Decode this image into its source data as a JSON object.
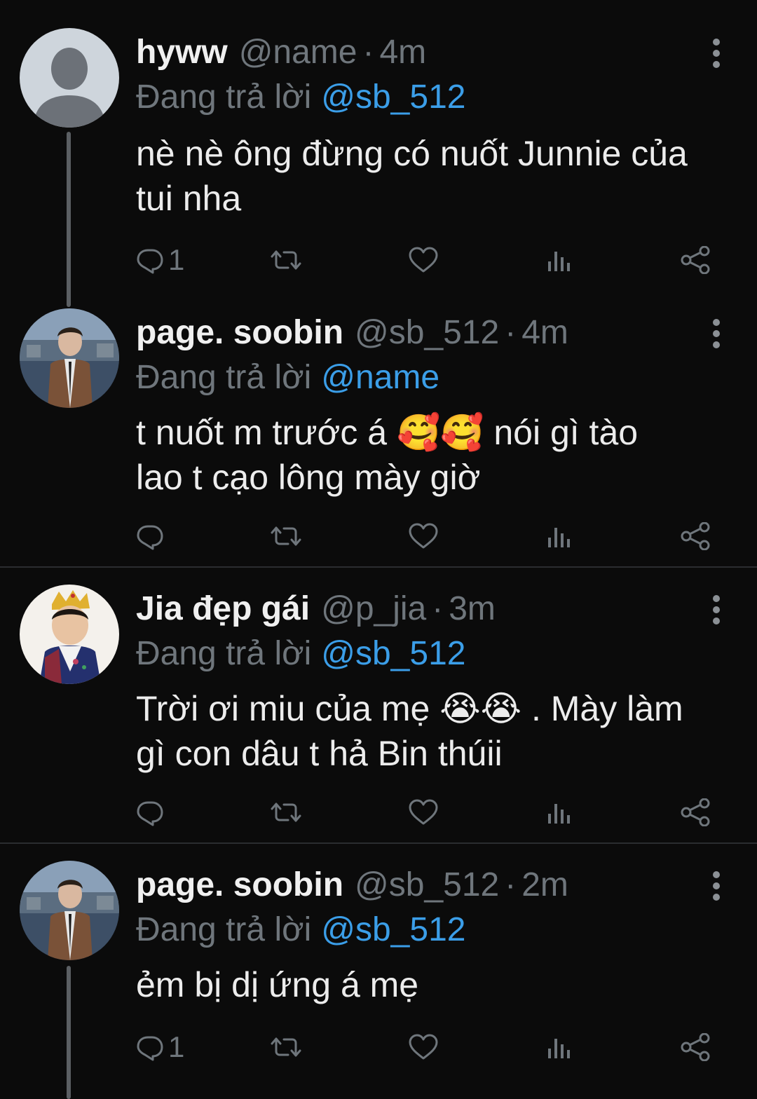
{
  "tweets": [
    {
      "name": "hyww",
      "handle": "@name",
      "dot": "·",
      "time": "4m",
      "replying_label": "Đang trả lời",
      "mention": "@sb_512",
      "text_lines": [
        "nè nè ông đừng có nuốt Junnie của",
        "tui nha"
      ],
      "reply_count": "1",
      "avatar": "default-avatar"
    },
    {
      "name": "page. soobin",
      "handle": "@sb_512",
      "dot": "·",
      "time": "4m",
      "replying_label": "Đang trả lời",
      "mention": "@name",
      "text_parts": [
        "t nuốt m trước á ",
        "🥰🥰",
        " nói gì tào"
      ],
      "text_line2": "lao t cạo lông mày giờ",
      "reply_count": "",
      "avatar": "photo-avatar-boy"
    },
    {
      "name": "Jia đẹp gái",
      "handle": "@p_jia",
      "dot": "·",
      "time": "3m",
      "replying_label": "Đang trả lời",
      "mention": "@sb_512",
      "text_parts": [
        "Trời ơi miu của mẹ ",
        "😭😭",
        " . Mày làm"
      ],
      "text_line2": "gì con dâu t hả Bin thúii",
      "reply_count": "",
      "avatar": "photo-avatar-child"
    },
    {
      "name": "page. soobin",
      "handle": "@sb_512",
      "dot": "·",
      "time": "2m",
      "replying_label": "Đang trả lời",
      "mention": "@sb_512",
      "text_line1": "ẻm bị dị ứng á mẹ",
      "reply_count": "1",
      "avatar": "photo-avatar-boy"
    }
  ],
  "colors": {
    "background": "#0b0b0b",
    "secondary_text": "#6f767c",
    "mention": "#3b9ee8",
    "divider": "#2b2d30"
  },
  "icons": [
    "reply-icon",
    "retweet-icon",
    "like-icon",
    "analytics-icon",
    "share-icon",
    "more-icon"
  ]
}
